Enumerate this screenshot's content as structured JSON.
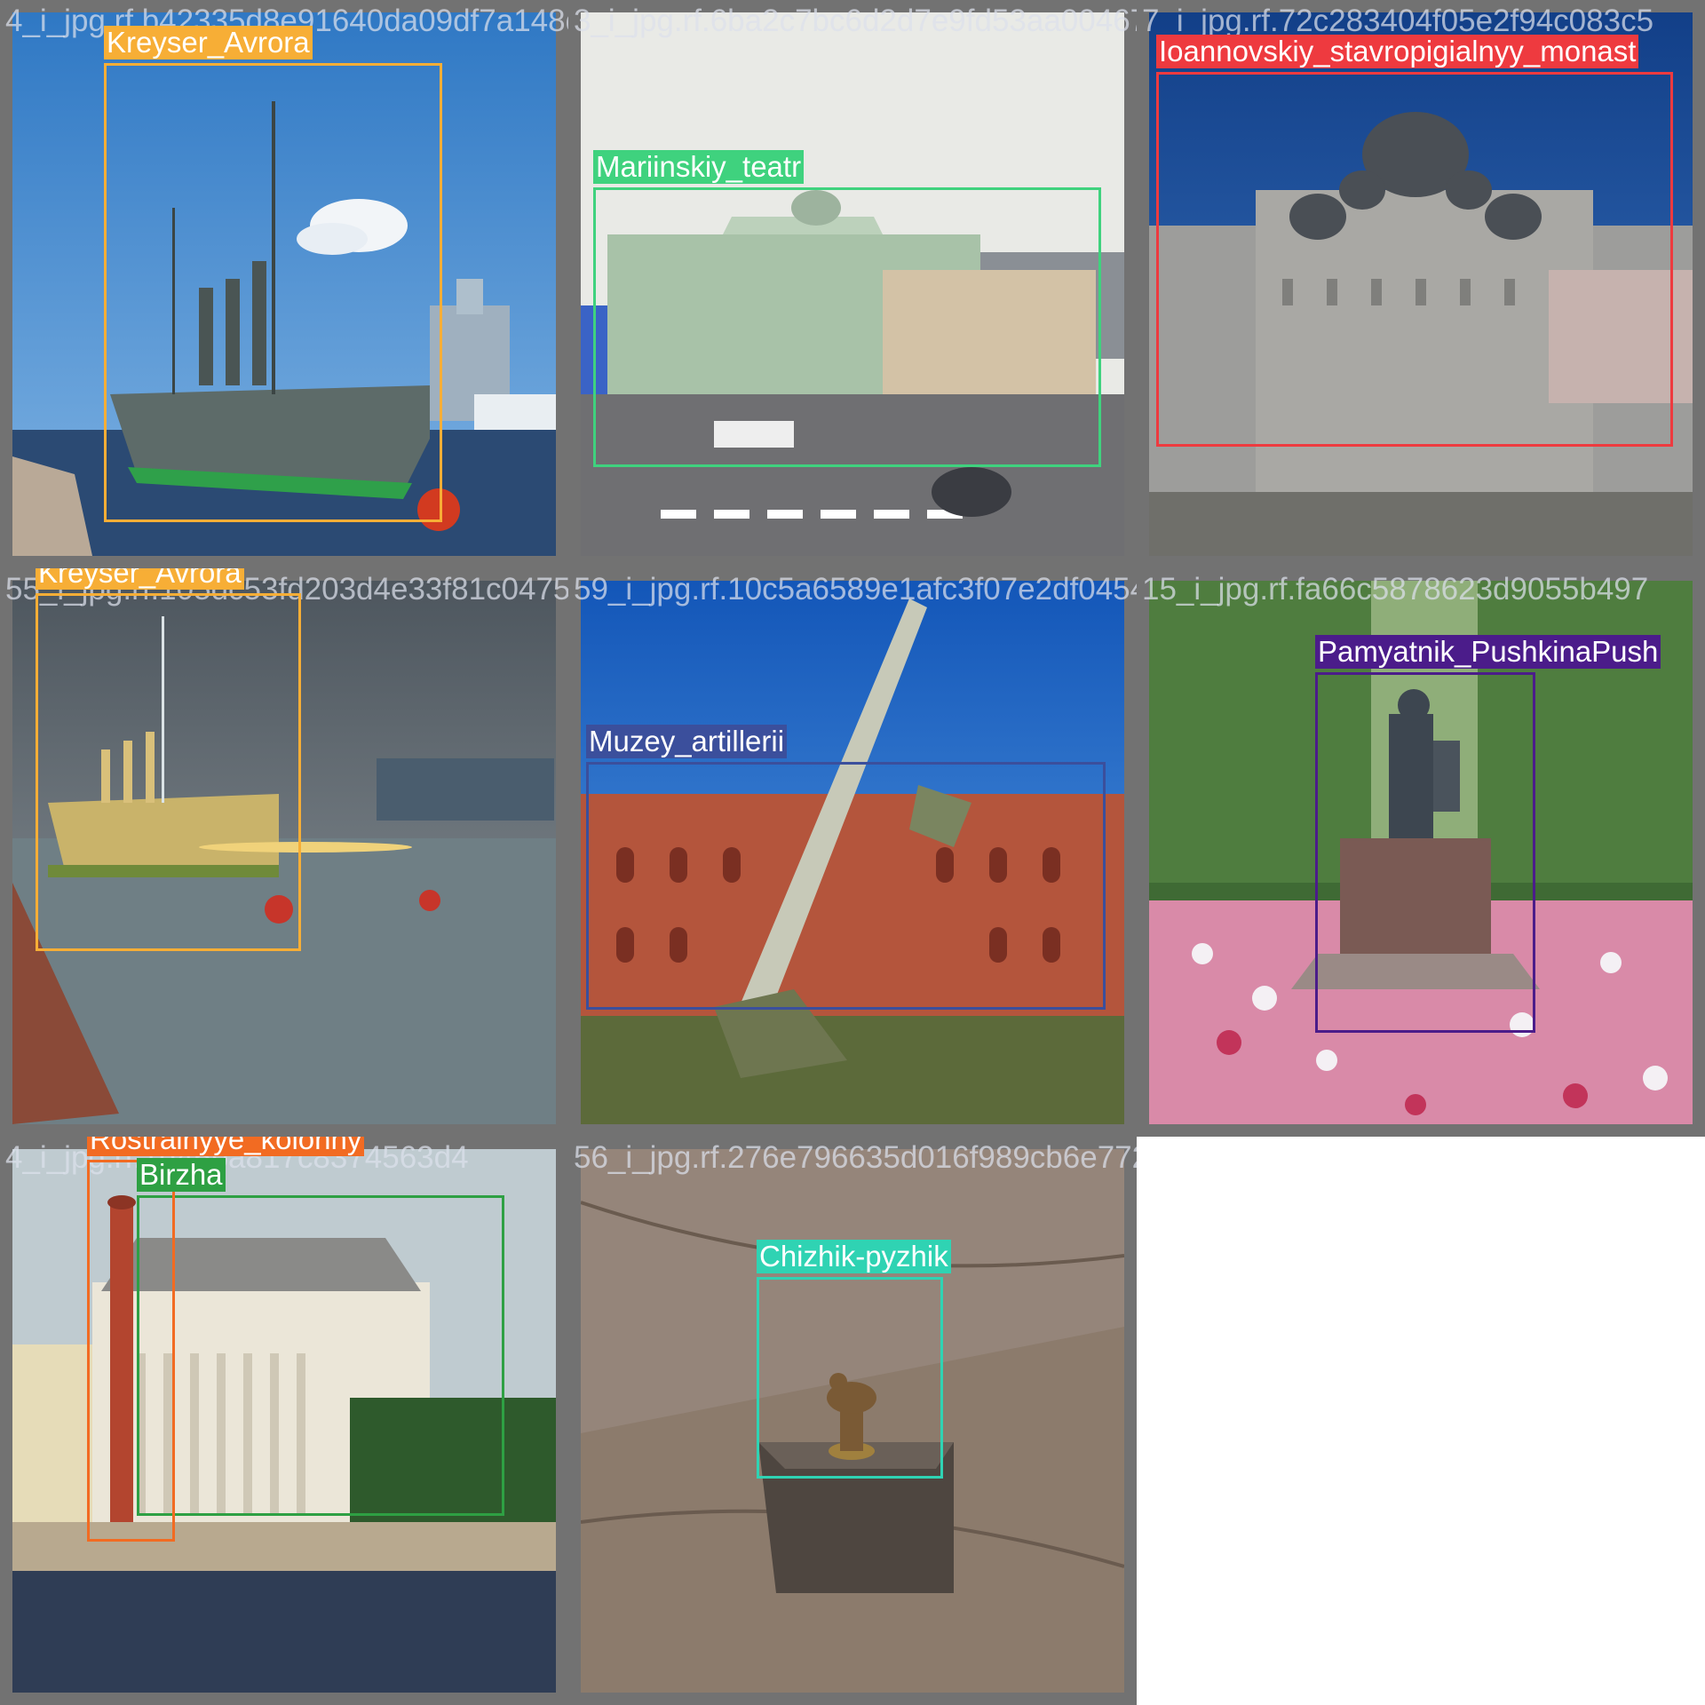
{
  "tiles": [
    {
      "filename": "4_i_jpg.rf.b42335d8e91640da09df7a148d757",
      "scene_colors": {
        "sky": "#4a8fd1",
        "water": "#2b4a73",
        "hull": "#5d6b69",
        "stripe": "#2fa04a"
      },
      "boxes": [
        {
          "label": "Kreyser_Avrora",
          "color": "#f7ae36"
        }
      ]
    },
    {
      "filename": "3_i_jpg.rf.6ba2c7bc6d2d7e9fd53aa00467cd4",
      "scene_colors": {
        "sky": "#e9eae6",
        "building": "#a8c2a8",
        "road": "#6f6f72"
      },
      "boxes": [
        {
          "label": "Mariinskiy_teatr",
          "color": "#3fd27e"
        }
      ]
    },
    {
      "filename": "7_i_jpg.rf.72c283404f05e2f94c083c5",
      "scene_colors": {
        "sky": "#1d4f99",
        "building": "#9d9d9b",
        "dome": "#4a4f55"
      },
      "boxes": [
        {
          "label": "Ioannovskiy_stavropigialnyy_monast",
          "color": "#ee3a3f"
        }
      ]
    },
    {
      "filename": "55_i_jpg.rf.105dc53fd203d4e33f81c0475",
      "scene_colors": {
        "sky": "#5f6870",
        "water": "#6f7f85",
        "lights": "#f0d27a"
      },
      "boxes": [
        {
          "label": "Kreyser_Avrora",
          "color": "#f7ae36"
        }
      ]
    },
    {
      "filename": "59_i_jpg.rf.10c5a6589e1afc3f07e2df0454",
      "scene_colors": {
        "sky": "#1f6fcf",
        "building": "#b4553c",
        "grass": "#5c6a3a"
      },
      "boxes": [
        {
          "label": "Muzey_artillerii",
          "color": "#3b4f9c"
        }
      ]
    },
    {
      "filename": "15_i_jpg.rf.fa66c5878623d9055b497",
      "scene_colors": {
        "trees": "#3f6a34",
        "flowers": "#d98aa8",
        "pedestal": "#7a5a54"
      },
      "boxes": [
        {
          "label": "Pamyatnik_PushkinaPush",
          "color": "#4b1c8a"
        }
      ]
    },
    {
      "filename": "4_i_jpg.rf.1d45ba817c8374563d4",
      "scene_colors": {
        "sky": "#bfcbd0",
        "building": "#ebe6d8",
        "column": "#b3452f",
        "water": "#2f3d55"
      },
      "boxes": [
        {
          "label": "Rostralnyye_kolonny",
          "color": "#f26b22"
        },
        {
          "label": "Birzha",
          "color": "#2ea043"
        }
      ]
    },
    {
      "filename": "56_i_jpg.rf.276e796635d016f989cb6e7720d7",
      "scene_colors": {
        "stone": "#8c7b6c",
        "bird": "#7a5a35"
      },
      "boxes": [
        {
          "label": "Chizhik-pyzhik",
          "color": "#2fd3b3"
        }
      ]
    }
  ]
}
